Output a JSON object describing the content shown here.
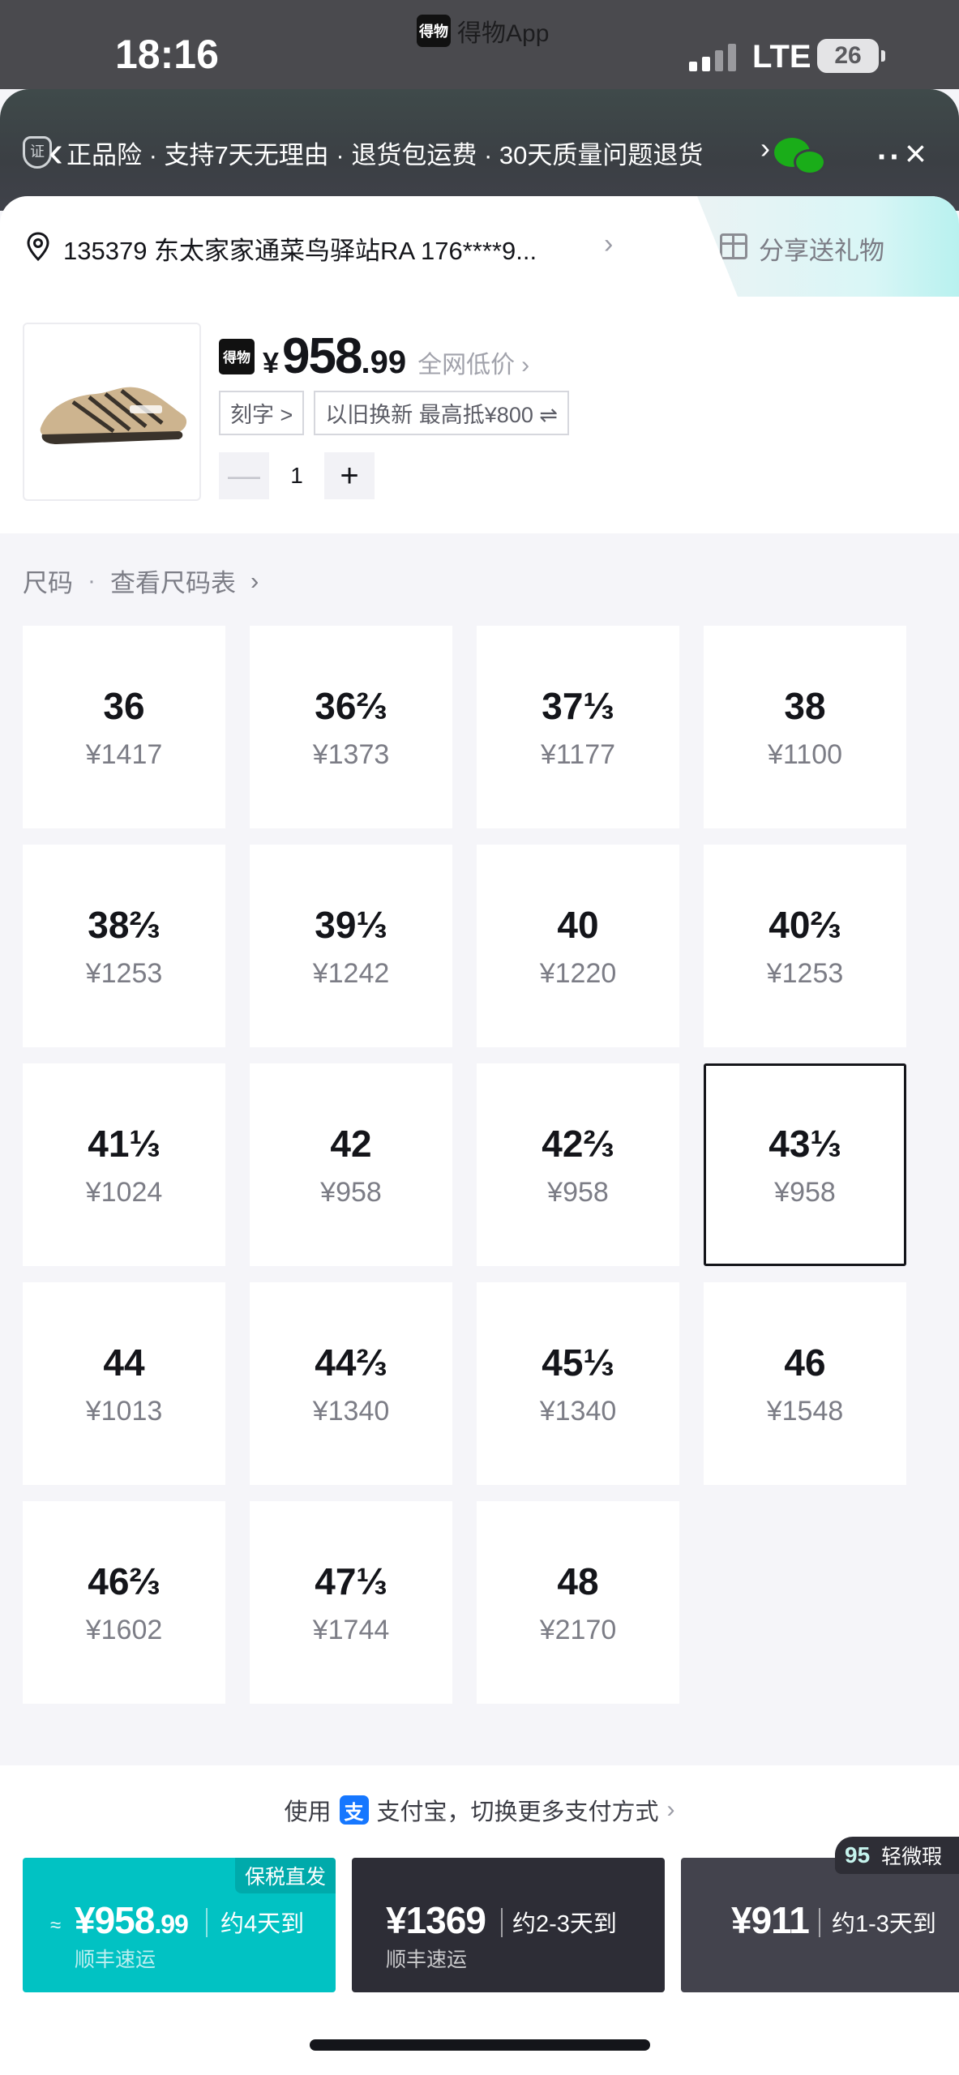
{
  "status_bar": {
    "time": "18:16",
    "app_name": "得物App",
    "network": "LTE",
    "battery": "26"
  },
  "guarantee_bar": {
    "text": "正品险 · 支持7天无理由 · 退货包运费 · 30天质量问题退货"
  },
  "address": {
    "text": "135379 东太家家通菜鸟驿站RA 176****9..."
  },
  "share": {
    "label": "分享送礼物"
  },
  "product": {
    "currency": "¥",
    "price_main": "958",
    "price_dec": ".99",
    "lowest_label": "全网低价",
    "tags": [
      "刻字 >",
      "以旧换新 最高抵¥800 ⇌"
    ],
    "quantity": "1"
  },
  "size_section": {
    "label": "尺码",
    "chart_link": "查看尺码表",
    "sizes": [
      {
        "size": "36",
        "price": "¥1417"
      },
      {
        "size": "36⅔",
        "price": "¥1373"
      },
      {
        "size": "37⅓",
        "price": "¥1177"
      },
      {
        "size": "38",
        "price": "¥1100"
      },
      {
        "size": "38⅔",
        "price": "¥1253"
      },
      {
        "size": "39⅓",
        "price": "¥1242"
      },
      {
        "size": "40",
        "price": "¥1220"
      },
      {
        "size": "40⅔",
        "price": "¥1253"
      },
      {
        "size": "41⅓",
        "price": "¥1024"
      },
      {
        "size": "42",
        "price": "¥958"
      },
      {
        "size": "42⅔",
        "price": "¥958"
      },
      {
        "size": "43⅓",
        "price": "¥958",
        "selected": true
      },
      {
        "size": "44",
        "price": "¥1013"
      },
      {
        "size": "44⅔",
        "price": "¥1340"
      },
      {
        "size": "45⅓",
        "price": "¥1340"
      },
      {
        "size": "46",
        "price": "¥1548"
      },
      {
        "size": "46⅔",
        "price": "¥1602"
      },
      {
        "size": "47⅓",
        "price": "¥1744"
      },
      {
        "size": "48",
        "price": "¥2170"
      }
    ]
  },
  "payment": {
    "prefix": "使用",
    "text": "支付宝，切换更多支付方式"
  },
  "buy_options": [
    {
      "tag": "保税直发",
      "approx": "≈",
      "price": "¥958",
      "price_dec": ".99",
      "eta": "约4天到",
      "courier": "顺丰速运"
    },
    {
      "price": "¥1369",
      "eta": "约2-3天到",
      "courier": "顺丰速运"
    },
    {
      "price": "¥911",
      "eta": "约1-3天到"
    }
  ],
  "light_badge": {
    "number": "95",
    "label": "轻微瑕"
  },
  "colors": {
    "teal": "#01c2c3",
    "dark": "#2d2d36",
    "gray_button": "#43434d",
    "alipay": "#1677ff"
  }
}
